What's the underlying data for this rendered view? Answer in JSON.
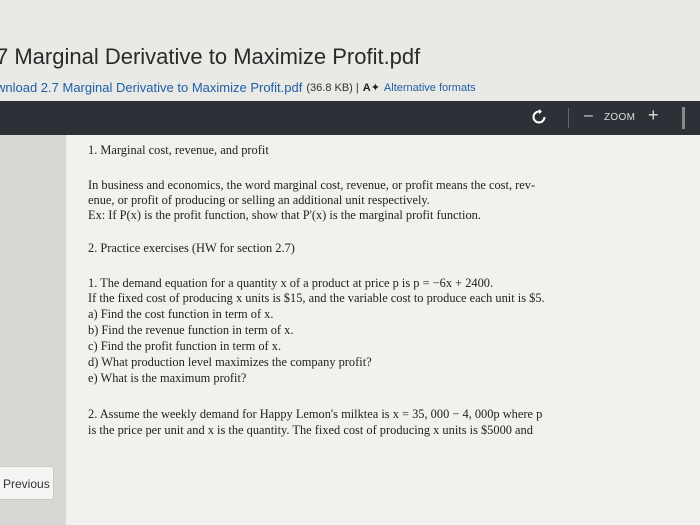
{
  "document": {
    "title": "7 Marginal Derivative to Maximize Profit.pdf",
    "download_label": "wnload 2.7 Marginal Derivative to Maximize Profit.pdf",
    "file_size": "(36.8 KB) |",
    "alt_icon": "A✦",
    "alt_formats_label": "Alternative formats"
  },
  "toolbar": {
    "zoom_out": "–",
    "zoom_label": "ZOOM",
    "zoom_in": "+"
  },
  "pdf": {
    "section1": "1. Marginal cost, revenue, and profit",
    "para1_line1": "In business and economics, the word marginal cost, revenue, or profit means the cost, rev-",
    "para1_line2": "enue, or profit of producing or selling an additional unit respectively.",
    "para1_line3": "Ex: If P(x) is the profit function, show that P'(x) is the marginal profit function.",
    "section2": "2. Practice exercises (HW for section 2.7)",
    "ex1_line1": "1.  The demand equation for a quantity x of a product at price p is p = −6x + 2400.",
    "ex1_line2": "If the fixed cost of producing x units is $15, and the variable cost to produce each unit is $5.",
    "ex1_a": "a) Find the cost function in term of x.",
    "ex1_b": "b) Find the revenue function in term of x.",
    "ex1_c": "c) Find the profit function in term of x.",
    "ex1_d": "d) What production level maximizes the company profit?",
    "ex1_e": "e) What is the maximum profit?",
    "ex2_line1": "2. Assume the weekly demand for Happy Lemon's milktea is x = 35, 000 − 4, 000p where p",
    "ex2_line2": "is the price per unit and x is the quantity. The fixed cost of producing x units is $5000 and"
  },
  "nav": {
    "previous_label": "Previous"
  }
}
